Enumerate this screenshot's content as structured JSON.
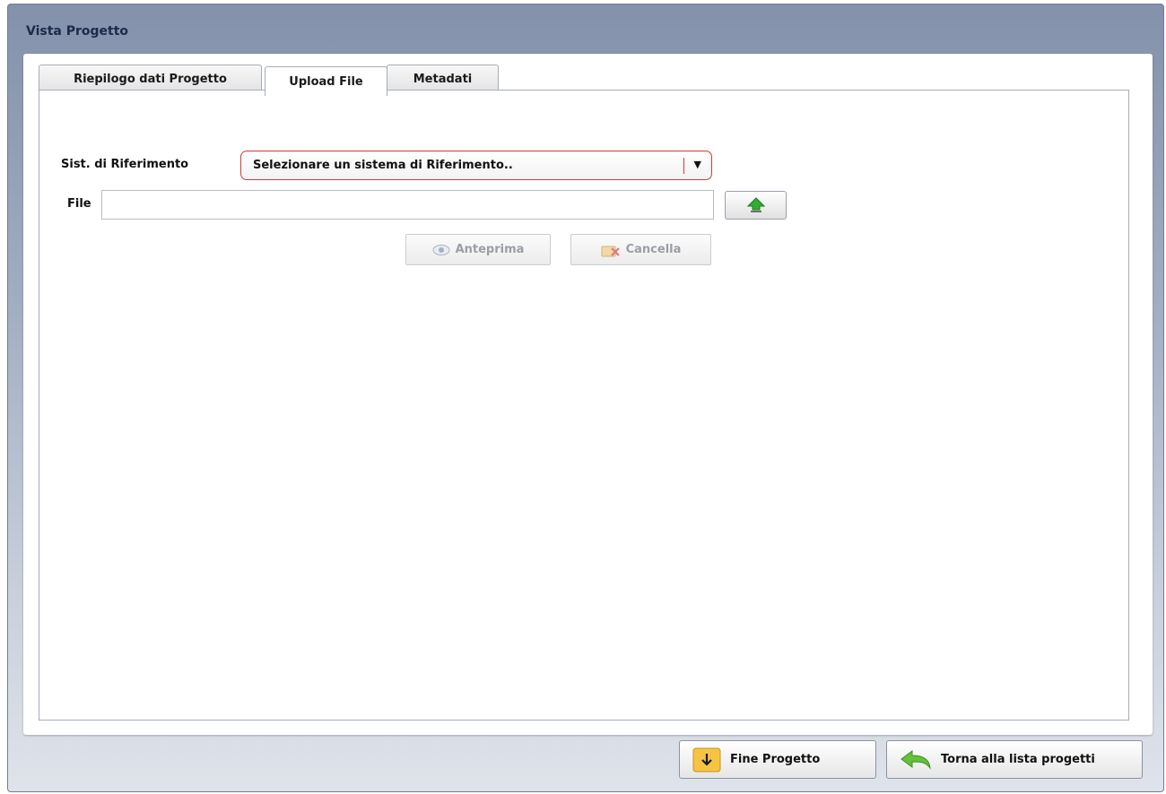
{
  "window": {
    "title": "Vista Progetto"
  },
  "tabs": [
    {
      "label": "Riepilogo dati Progetto",
      "active": false
    },
    {
      "label": "Upload File",
      "active": true
    },
    {
      "label": "Metadati",
      "active": false
    }
  ],
  "form": {
    "reference_label": "Sist. di Riferimento",
    "reference_select_value": "Selezionare un sistema di Riferimento..",
    "file_label": "File",
    "file_value": "",
    "preview_label": "Anteprima",
    "delete_label": "Cancella"
  },
  "footer": {
    "fine_label": "Fine Progetto",
    "torna_label": "Torna alla lista progetti"
  },
  "colors": {
    "title_bar": "#8391ab",
    "select_border": "#d23a3a",
    "upload_arrow": "#2fae2f",
    "disabled_text": "#9a9ea5"
  },
  "icons": {
    "select": "chevron-down-icon",
    "upload": "upload-arrow-icon",
    "preview": "eye-icon",
    "delete": "delete-folder-icon",
    "fine": "download-arrow-icon",
    "torna": "back-arrow-icon"
  }
}
